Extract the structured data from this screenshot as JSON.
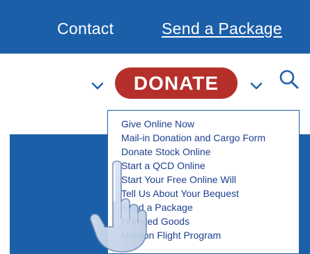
{
  "header": {
    "contact_label": "Contact",
    "send_package_label": "Send a Package"
  },
  "nav": {
    "donate_label": "DONATE",
    "left_chevron": "chevron-down-icon",
    "right_chevron": "chevron-down-icon",
    "search_icon": "search-icon"
  },
  "dropdown": {
    "items": [
      {
        "label": "Give Online Now"
      },
      {
        "label": "Mail-in Donation and Cargo Form"
      },
      {
        "label": "Donate Stock Online"
      },
      {
        "label": "Start a QCD Online"
      },
      {
        "label": "Start Your Free Online Will"
      },
      {
        "label": "Tell Us About Your Bequest"
      },
      {
        "label": "Send a Package"
      },
      {
        "label": "Donated Goods"
      },
      {
        "label": "Mission Flight Program"
      }
    ]
  },
  "colors": {
    "brand_blue": "#1c5fa9",
    "donate_red": "#b5302b",
    "link_blue": "#1c3f8f"
  },
  "cursor": {
    "icon": "pointing-hand-icon"
  }
}
